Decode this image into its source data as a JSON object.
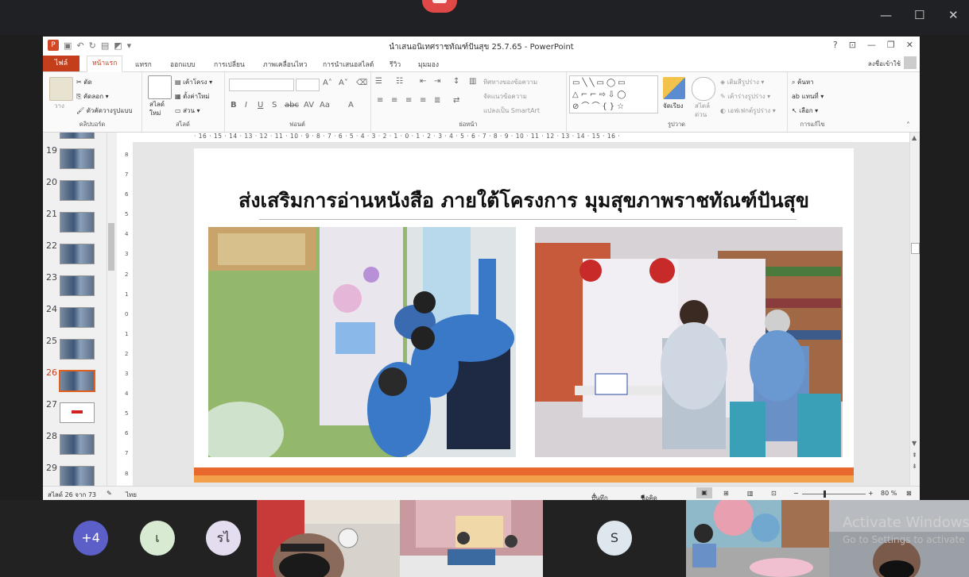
{
  "window": {
    "title": "นำเสนอนิเทศราชทัณฑ์ปันสุข 25.7.65 - PowerPoint",
    "help": "?",
    "minimize": "—",
    "restore": "❐",
    "close": "✕"
  },
  "outer_controls": {
    "minimize": "—",
    "maximize": "☐",
    "close": "✕"
  },
  "tabs": {
    "file": "ไฟล์",
    "items": [
      "หน้าแรก",
      "แทรก",
      "ออกแบบ",
      "การเปลี่ยน",
      "ภาพเคลื่อนไหว",
      "การนำเสนอสไลด์",
      "รีวิว",
      "มุมมอง"
    ],
    "active": "หน้าแรก",
    "signin": "ลงชื่อเข้าใช้"
  },
  "ribbon": {
    "clipboard": {
      "label": "คลิปบอร์ด",
      "paste": "วาง",
      "cut": "ตัด",
      "copy": "คัดลอก",
      "format_painter": "ตัวคัดวางรูปแบบ"
    },
    "slides": {
      "label": "สไลด์",
      "new_slide_1": "สไลด์",
      "new_slide_2": "ใหม่",
      "layout": "เค้าโครง",
      "reset": "ตั้งค่าใหม่",
      "section": "ส่วน"
    },
    "font": {
      "label": "ฟอนต์",
      "name": "",
      "size": ""
    },
    "paragraph": {
      "label": "ย่อหน้า",
      "text_direction": "ทิศทางของข้อความ",
      "align_text": "จัดแนวข้อความ",
      "smartart": "แปลงเป็น SmartArt"
    },
    "drawing": {
      "label": "รูปวาด",
      "arrange": "จัดเรียง",
      "quick_styles_1": "สไตล์",
      "quick_styles_2": "ด่วน",
      "fill": "เติมสีรูปร่าง",
      "outline": "เค้าร่างรูปร่าง",
      "effects": "เอฟเฟกต์รูปร่าง"
    },
    "editing": {
      "label": "การแก้ไข",
      "find": "ค้นหา",
      "replace": "แทนที่",
      "select": "เลือก"
    }
  },
  "thumbnails": [
    {
      "num": "19"
    },
    {
      "num": "20"
    },
    {
      "num": "21"
    },
    {
      "num": "22"
    },
    {
      "num": "23"
    },
    {
      "num": "24"
    },
    {
      "num": "25"
    },
    {
      "num": "26"
    },
    {
      "num": "27"
    },
    {
      "num": "28"
    },
    {
      "num": "29"
    }
  ],
  "selected_slide": "26",
  "ruler": {
    "horizontal": "· 16 · 15 · 14 · 13 · 12 · 11 · 10 · 9 · 8 · 7 · 6 · 5 · 4 · 3 · 2 · 1 · 0 · 1 · 2 · 3 · 4 · 5 · 6 · 7 · 8 · 9 · 10 · 11 · 12 · 13 · 14 · 15 · 16 ·",
    "vertical": [
      "8",
      "7",
      "6",
      "5",
      "4",
      "3",
      "2",
      "1",
      "0",
      "1",
      "2",
      "3",
      "4",
      "5",
      "6",
      "7",
      "8"
    ]
  },
  "slide": {
    "title": "ส่งเสริมการอ่านหนังสือ ภายใต้โครงการ มุมสุขภาพราชทัณฑ์ปันสุข"
  },
  "status": {
    "slide_info": "สไลด์ 26 จาก 73",
    "language": "ไทย",
    "notes": "บันทึกย่อ",
    "comments": "ข้อคิดเห็น",
    "zoom": "80 %"
  },
  "meeting": {
    "participants": [
      {
        "label": "+4",
        "bg": "#5b5fc7",
        "fg": "#ffffff"
      },
      {
        "label": "เ",
        "bg": "#d9ead3",
        "fg": "#333333"
      },
      {
        "label": "รไ",
        "bg": "#e4dcef",
        "fg": "#333333"
      },
      {
        "label": "S",
        "bg": "#dfe7ee",
        "fg": "#333333"
      }
    ],
    "activate_title": "Activate Windows",
    "activate_sub": "Go to Settings to activate"
  }
}
